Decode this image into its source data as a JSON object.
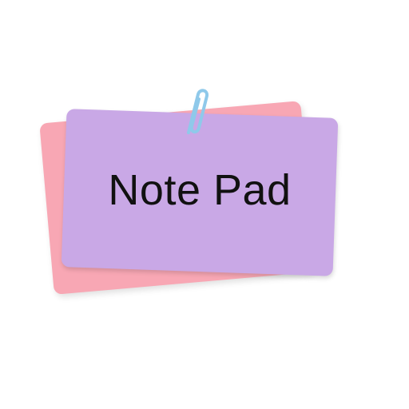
{
  "title": "Note Pad",
  "colors": {
    "back_card": "#f8a7b4",
    "front_card": "#c9a8e6",
    "paperclip": "#8fc9ea",
    "text": "#111111"
  },
  "icons": {
    "paperclip": "paperclip-icon"
  }
}
